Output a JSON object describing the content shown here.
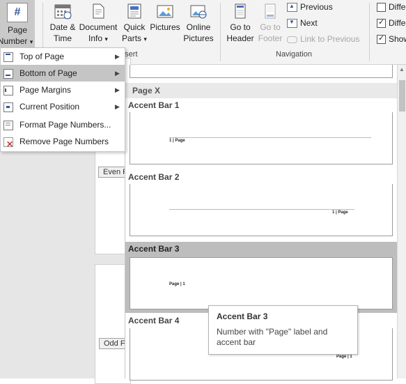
{
  "ribbon": {
    "page_number_btn": {
      "line1": "Page",
      "line2": "Number",
      "caret": "▾",
      "icon": "hash-icon"
    },
    "buttons": [
      {
        "line1": "Date &",
        "line2": "Time",
        "icon": "calendar-icon"
      },
      {
        "line1": "Document",
        "line2": "Info",
        "caret": "▾",
        "icon": "document-info-icon"
      },
      {
        "line1": "Quick",
        "line2": "Parts",
        "caret": "▾",
        "icon": "quick-parts-icon"
      },
      {
        "line1": "Pictures",
        "line2": "",
        "icon": "pictures-icon"
      },
      {
        "line1": "Online",
        "line2": "Pictures",
        "icon": "online-pictures-icon"
      }
    ],
    "insert_group_label": "Insert",
    "nav_buttons": [
      {
        "line1": "Go to",
        "line2": "Header",
        "enabled": true,
        "icon": "goto-header-icon"
      },
      {
        "line1": "Go to",
        "line2": "Footer",
        "enabled": false,
        "icon": "goto-footer-icon"
      }
    ],
    "nav_links": [
      {
        "label": "Previous",
        "enabled": true
      },
      {
        "label": "Next",
        "enabled": true
      },
      {
        "label": "Link to Previous",
        "enabled": false
      }
    ],
    "navigation_group_label": "Navigation",
    "options": [
      {
        "label": "Diffe",
        "checked": false
      },
      {
        "label": "Diffe",
        "checked": true
      },
      {
        "label": "Show",
        "checked": true
      }
    ]
  },
  "menu": {
    "items": [
      {
        "label": "Top of Page",
        "submenu": true,
        "highlighted": false,
        "icon": "top-of-page-icon"
      },
      {
        "label": "Bottom of Page",
        "submenu": true,
        "highlighted": true,
        "icon": "bottom-of-page-icon"
      },
      {
        "label": "Page Margins",
        "submenu": true,
        "highlighted": false,
        "icon": "page-margins-icon"
      },
      {
        "label": "Current Position",
        "submenu": true,
        "highlighted": false,
        "icon": "current-position-icon"
      },
      {
        "label": "Format Page Numbers...",
        "submenu": false,
        "highlighted": false,
        "icon": "format-page-numbers-icon"
      },
      {
        "label": "Remove Page Numbers",
        "submenu": false,
        "highlighted": false,
        "icon": "remove-page-numbers-icon"
      }
    ],
    "submenu_arrow": "▶"
  },
  "document": {
    "even_tag": "Even F",
    "odd_tag": "Odd F"
  },
  "gallery": {
    "section_header": "Page X",
    "items": [
      {
        "title": "Accent Bar 1",
        "preview": "1 | Page",
        "selected": false
      },
      {
        "title": "Accent Bar 2",
        "preview": "1 | Page",
        "selected": false
      },
      {
        "title": "Accent Bar 3",
        "preview": "Page | 1",
        "selected": true
      },
      {
        "title": "Accent Bar 4",
        "preview": "Page | 1",
        "selected": false
      }
    ]
  },
  "tooltip": {
    "title": "Accent Bar 3",
    "body": "Number with \"Page\" label and accent bar"
  },
  "colors": {
    "highlight": "#c5c5c5",
    "selected_item": "#bdbdbd",
    "ribbon_bg": "#f3f3f3"
  }
}
